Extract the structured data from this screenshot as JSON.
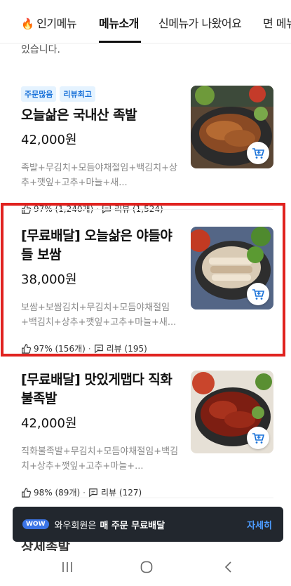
{
  "tabs": [
    {
      "label": "인기메뉴",
      "icon": "fire-icon"
    },
    {
      "label": "메뉴소개",
      "active": true
    },
    {
      "label": "신메뉴가 나왔어요"
    },
    {
      "label": "면 메뉴"
    }
  ],
  "intro_text": "있습니다.",
  "items": [
    {
      "badges": [
        "주문많음",
        "리뷰최고"
      ],
      "name": "오늘삶은 국내산 족발",
      "price": "42,000원",
      "description": "족발+무김치+모듬야채절임+백김치+상추+깻잎+고추+마늘+새...",
      "like": "97% (1,240개)",
      "review": "리뷰 (1,524)"
    },
    {
      "badges": [],
      "name": "[무료배달] 오늘삶은 야들야들 보쌈",
      "price": "38,000원",
      "description": "보쌈+보쌈김치+무김치+모듬야채절임+백김치+상추+깻잎+고추+마늘+새...",
      "like": "97% (156개)",
      "review": "리뷰 (195)"
    },
    {
      "badges": [],
      "name": "[무료배달] 맛있게맵다 직화불족발",
      "price": "42,000원",
      "description": "직화불족발+무김치+모듬야채절임+백김치+상추+깻잎+고추+마늘+...",
      "like": "98% (89개)",
      "review": "리뷰 (127)"
    }
  ],
  "next_item_peek": "상세족발",
  "banner": {
    "badge": "WOW",
    "text": "와우회원은",
    "bold": "매 주문 무료배달",
    "more": "자세히"
  },
  "colors": {
    "accent": "#1a72d9",
    "highlight": "#e0221f",
    "banner_bg": "#22272e",
    "wow": "#3b74e6"
  }
}
